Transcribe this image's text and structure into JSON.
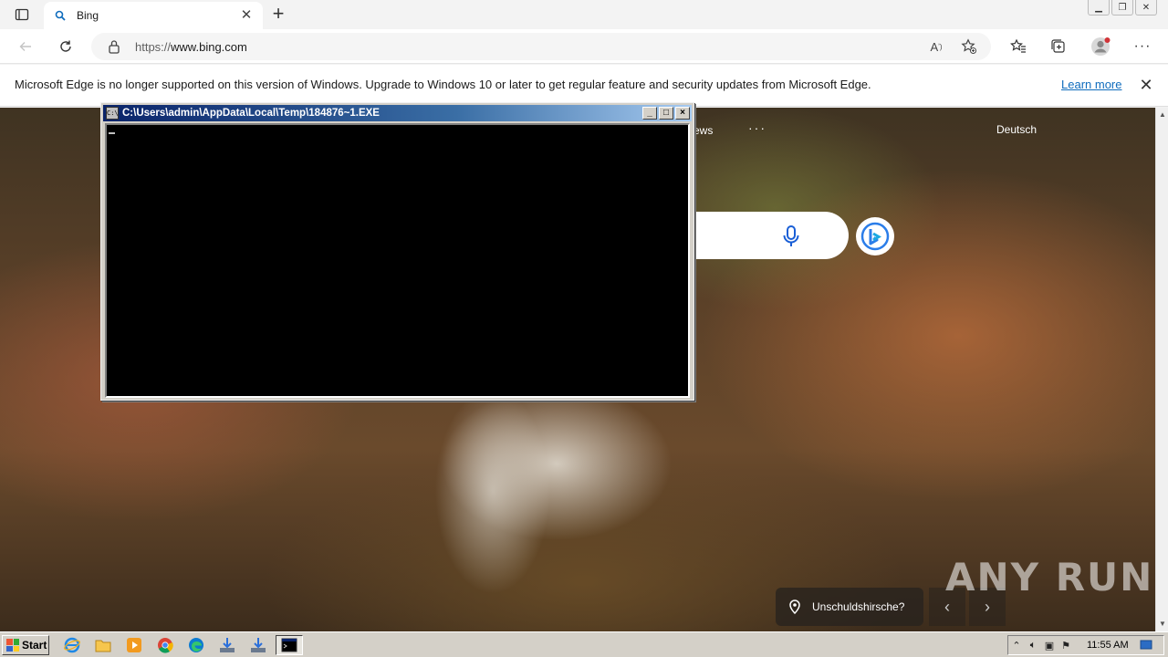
{
  "browser": {
    "tab": {
      "title": "Bing"
    },
    "address": {
      "prefix": "https://",
      "host": "www.bing.com"
    },
    "toolbar_icons": [
      "back-icon",
      "refresh-icon",
      "lock-icon",
      "read-aloud-icon",
      "add-favorite-icon",
      "favorites-icon",
      "collections-icon",
      "profile-icon",
      "more-icon"
    ]
  },
  "infobar": {
    "message": "Microsoft Edge is no longer supported on this version of Windows. Upgrade to Windows 10 or later to get regular feature and security updates from Microsoft Edge.",
    "link": "Learn more"
  },
  "bing": {
    "news": "ews",
    "more": "···",
    "language": "Deutsch",
    "caption": "Unschuldshirsche?",
    "watermark": "ANY RUN"
  },
  "console": {
    "title": "C:\\Users\\admin\\AppData\\Local\\Temp\\184876~1.EXE",
    "minimize": "_",
    "maximize": "□",
    "close": "×"
  },
  "taskbar": {
    "start": "Start",
    "clock": "11:55 AM"
  },
  "colors": {
    "link": "#0f6cbd",
    "console_title": "#0a246a",
    "taskbar": "#d4d0c8"
  }
}
